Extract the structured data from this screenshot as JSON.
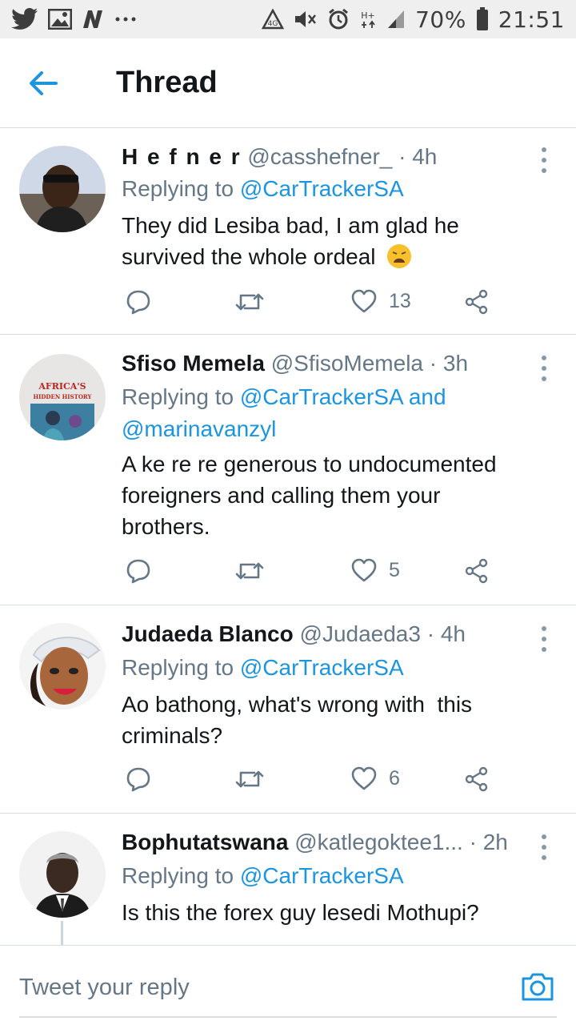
{
  "status_bar": {
    "left_icons": [
      "twitter-icon",
      "gallery-icon",
      "news-icon",
      "more-dots-icon"
    ],
    "right_icons": [
      "data-saver-icon",
      "mute-icon",
      "alarm-icon",
      "hplus-icon",
      "signal-icon",
      "battery-icon"
    ],
    "network": "H+",
    "battery": "70%",
    "time": "21:51"
  },
  "header": {
    "title": "Thread",
    "back_icon": "back-arrow-icon"
  },
  "tweets": [
    {
      "name": "H e f n e r",
      "handle": "@casshefner_",
      "dot": "·",
      "time": "4h",
      "replying_prefix": "Replying to ",
      "replying_to": "@CarTrackerSA",
      "replying_to2": "",
      "body_line1": "They did Lesiba bad, I am glad he",
      "body_line2": "survived the whole ordeal",
      "emoji": "weary-face-emoji",
      "likes": "13"
    },
    {
      "name": "Sfiso Memela",
      "handle": "@SfisoMemela",
      "dot": "·",
      "time": "3h",
      "replying_prefix": "Replying to ",
      "replying_to": "@CarTrackerSA and",
      "replying_to2": "@marinavanzyl",
      "body_line1": "A ke re re generous to undocumented",
      "body_line2": "foreigners and calling them your",
      "body_line3": "brothers.",
      "avatar_title": "AFRICA'S",
      "avatar_subtitle": "HIDDEN HISTORY",
      "likes": "5"
    },
    {
      "name": "Judaeda Blanco",
      "handle": "@Judaeda3",
      "dot": "·",
      "time": "4h",
      "replying_prefix": "Replying to ",
      "replying_to": "@CarTrackerSA",
      "body_line1": "Ao bathong, what's wrong with  this",
      "body_line2": "criminals?",
      "likes": "6"
    },
    {
      "name": "Bophutatswana",
      "handle": "@katlegoktee1...",
      "dot": "·",
      "time": "2h",
      "replying_prefix": "Replying to ",
      "replying_to": "@CarTrackerSA",
      "body_line1": "Is this the forex guy lesedi Mothupi?"
    }
  ],
  "reply_bar": {
    "placeholder": "Tweet your reply",
    "camera_icon": "camera-icon"
  },
  "colors": {
    "accent": "#1b95e0",
    "text": "#14171a",
    "muted": "#657786",
    "divider": "#d8dde1"
  }
}
